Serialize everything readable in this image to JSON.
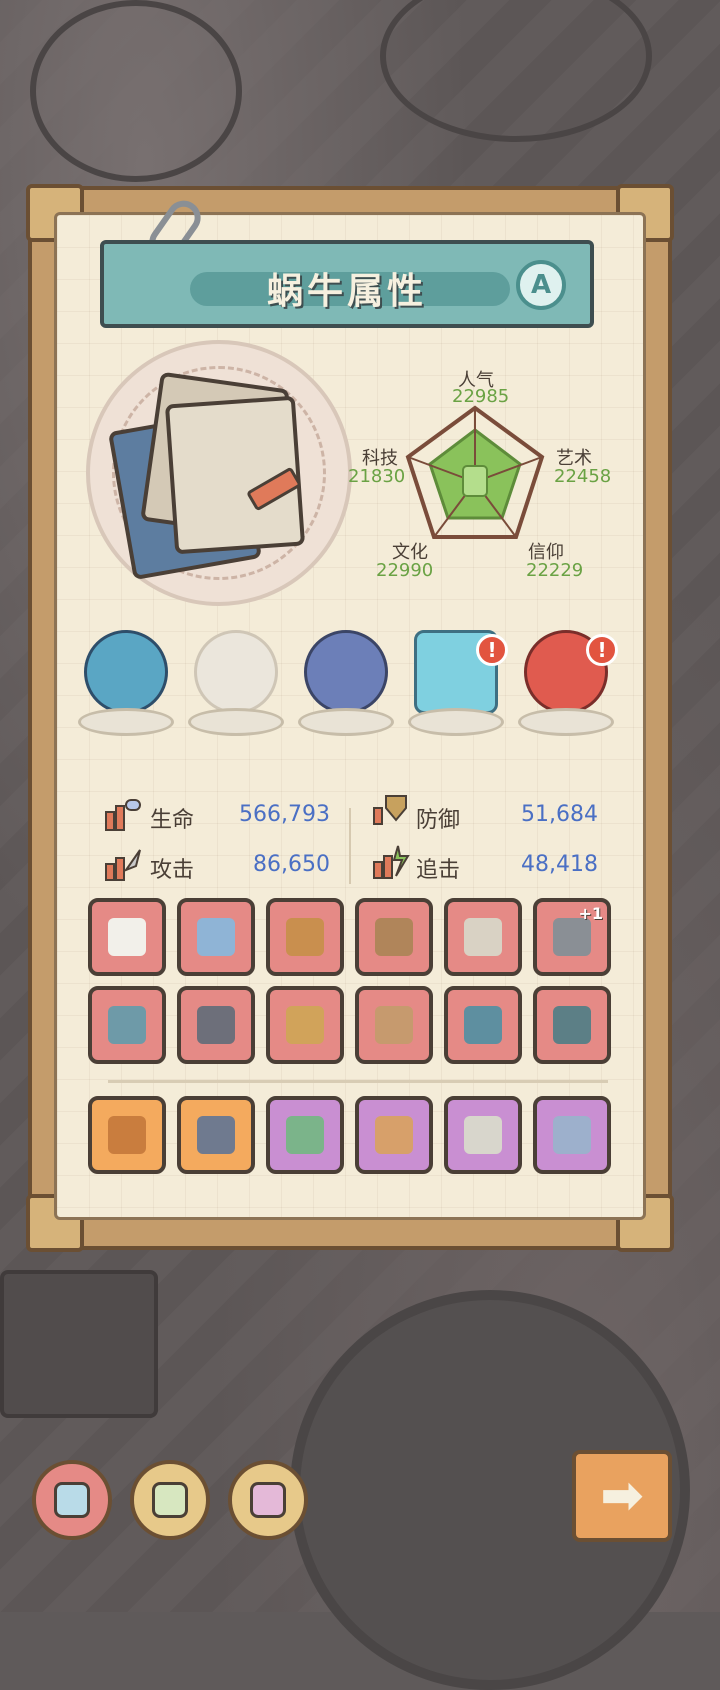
{
  "title": "蜗牛属性",
  "grade": "A",
  "radar": {
    "popularity": {
      "label": "人气",
      "value": "22985"
    },
    "art": {
      "label": "艺术",
      "value": "22458"
    },
    "tech": {
      "label": "科技",
      "value": "21830"
    },
    "culture": {
      "label": "文化",
      "value": "22990"
    },
    "faith": {
      "label": "信仰",
      "value": "22229"
    }
  },
  "orbs": [
    {
      "name": "monster-orb",
      "alert": ""
    },
    {
      "name": "empty-shell-orb",
      "alert": ""
    },
    {
      "name": "compass-orb",
      "alert": ""
    },
    {
      "name": "eye-tome-orb",
      "alert": "!"
    },
    {
      "name": "spiral-fruit-orb",
      "alert": "!"
    }
  ],
  "properties": {
    "hp": {
      "label": "生命",
      "value": "566,793"
    },
    "defense": {
      "label": "防御",
      "value": "51,684"
    },
    "attack": {
      "label": "攻击",
      "value": "86,650"
    },
    "chase": {
      "label": "追击",
      "value": "48,418"
    }
  },
  "equipment_badge": "+1",
  "colors": {
    "slot_red": "#e58a86",
    "slot_orange": "#f4aa5e",
    "slot_purple": "#c98fd2",
    "value_blue": "#4a6fc4",
    "radar_green": "#6aa244"
  }
}
